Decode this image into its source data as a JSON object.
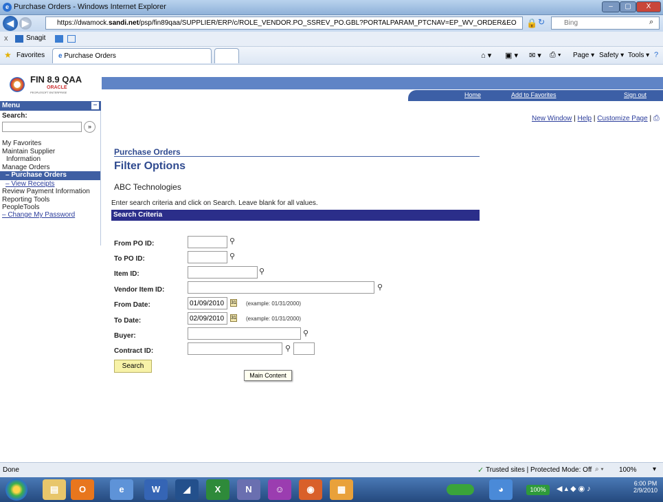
{
  "window": {
    "title": "Purchase Orders - Windows Internet Explorer",
    "min": "–",
    "max": "▢",
    "close": "X"
  },
  "address": {
    "url_prefix": "https://dwamock.",
    "url_host": "sandi.net",
    "url_rest": "/psp/fin89qaa/SUPPLIER/ERP/c/ROLE_VENDOR.PO_SSREV_PO.GBL?PORTALPARAM_PTCNAV=EP_WV_ORDER&EO",
    "search_placeholder": "Bing"
  },
  "snagit": {
    "close": "x",
    "label": "Snagit"
  },
  "favorites": {
    "label": "Favorites",
    "tab": "Purchase Orders",
    "tools": [
      "Page ▾",
      "Safety ▾",
      "Tools ▾"
    ]
  },
  "branding": {
    "product": "FIN 8.9 QAA",
    "oracle": "ORACLE",
    "sub": "PEOPLESOFT ENTERPRISE"
  },
  "topnav": {
    "home": "Home",
    "add_fav": "Add to Favorites",
    "signout": "Sign out"
  },
  "toplinks": {
    "new_window": "New Window",
    "help": "Help",
    "customize": "Customize Page",
    "sep": "|"
  },
  "menu": {
    "title": "Menu",
    "collapse": "–",
    "search_label": "Search:",
    "search_go": "»",
    "items": [
      "My Favorites",
      "Maintain Supplier",
      "Information",
      "Manage Orders",
      "– Purchase Orders",
      "– View Receipts",
      "Review Payment Information",
      "Reporting Tools",
      "PeopleTools",
      "– Change My Password"
    ]
  },
  "content": {
    "breadcrumb": "Purchase Orders",
    "title": "Filter Options",
    "company": "ABC Technologies",
    "instructions": "Enter search criteria and click on Search. Leave blank for all values.",
    "section": "Search Criteria"
  },
  "form": {
    "from_po": {
      "label": "From PO ID:",
      "value": ""
    },
    "to_po": {
      "label": "To PO ID:",
      "value": ""
    },
    "item": {
      "label": "Item ID:",
      "value": ""
    },
    "vendor_item": {
      "label": "Vendor Item ID:",
      "value": ""
    },
    "from_date": {
      "label": "From Date:",
      "value": "01/09/2010",
      "example": "(example: 01/31/2000)"
    },
    "to_date": {
      "label": "To Date:",
      "value": "02/09/2010",
      "example": "(example: 01/31/2000)"
    },
    "buyer": {
      "label": "Buyer:",
      "value": ""
    },
    "contract": {
      "label": "Contract ID:",
      "value": ""
    },
    "search_btn": "Search",
    "tooltip": "Main Content"
  },
  "status": {
    "done": "Done",
    "zone": "Trusted sites | Protected Mode: Off",
    "zoom": "100%"
  },
  "taskbar": {
    "time": "6:00 PM",
    "date": "2/9/2010",
    "battery": "100%"
  }
}
